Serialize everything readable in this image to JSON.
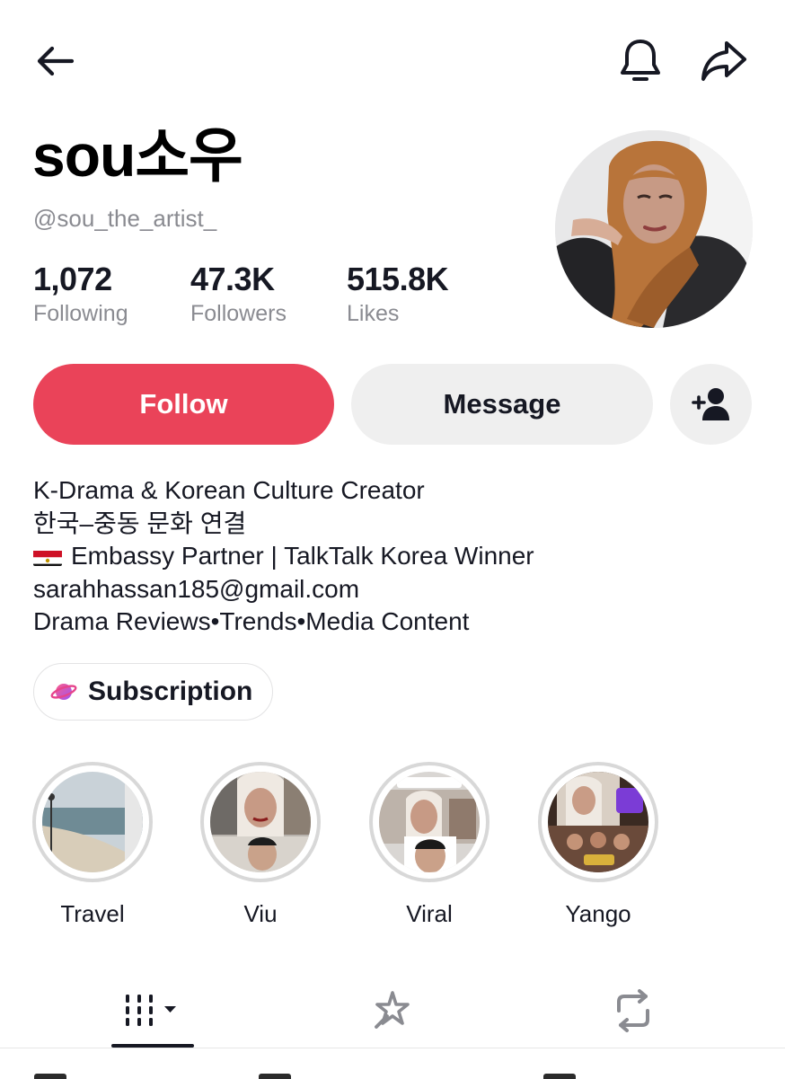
{
  "profile": {
    "display_name": "sou소우",
    "username": "@sou_the_artist_"
  },
  "stats": [
    {
      "value": "1,072",
      "label": "Following"
    },
    {
      "value": "47.3K",
      "label": "Followers"
    },
    {
      "value": "515.8K",
      "label": "Likes"
    }
  ],
  "actions": {
    "follow_label": "Follow",
    "message_label": "Message"
  },
  "bio": {
    "lines": [
      "K-Drama & Korean Culture Creator",
      "한국–중동 문화 연결",
      "Embassy Partner | TalkTalk Korea Winner",
      "sarahhassan185@gmail.com",
      "Drama Reviews•Trends•Media Content"
    ]
  },
  "subscription": {
    "label": "Subscription"
  },
  "highlights": [
    {
      "label": "Travel"
    },
    {
      "label": "Viu"
    },
    {
      "label": "Viral"
    },
    {
      "label": "Yango"
    }
  ],
  "colors": {
    "follow_button": "#ea4359",
    "secondary_button": "#efefef",
    "text_primary": "#161823",
    "text_secondary": "#8a8b91"
  },
  "icons": {
    "back": "arrow-left-icon",
    "notifications": "bell-icon",
    "share": "share-arrow-icon",
    "add_friend": "person-add-icon",
    "subscription": "planet-icon",
    "tab_videos": "grid-bars-icon",
    "tab_liked": "sparkle-wand-icon",
    "tab_reposts": "repost-icon"
  }
}
